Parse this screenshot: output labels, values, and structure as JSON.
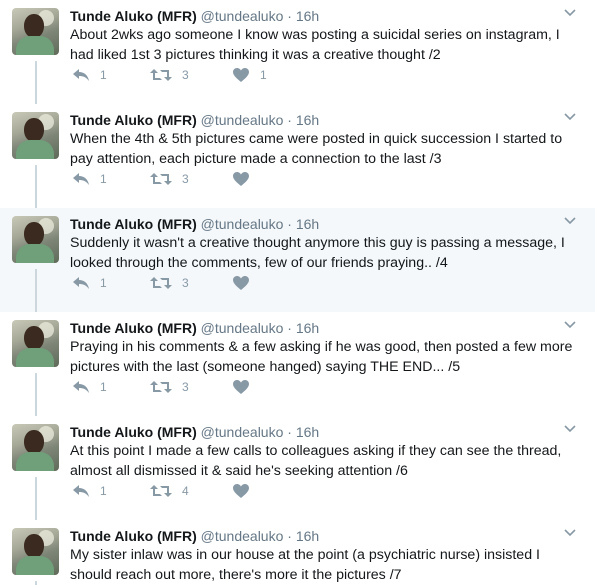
{
  "tweets": [
    {
      "name": "Tunde Aluko (MFR)",
      "handle": "@tundealuko",
      "time": "16h",
      "text": "About 2wks ago someone I know was posting a suicidal series on instagram, I had liked 1st 3 pictures thinking it was a creative thought /2",
      "replies": "1",
      "retweets": "3",
      "likes": "1",
      "highlighted": false
    },
    {
      "name": "Tunde Aluko (MFR)",
      "handle": "@tundealuko",
      "time": "16h",
      "text": "When the 4th & 5th pictures came were posted in quick succession I started to pay attention, each picture made a connection to the last /3",
      "replies": "1",
      "retweets": "3",
      "likes": "",
      "highlighted": false
    },
    {
      "name": "Tunde Aluko (MFR)",
      "handle": "@tundealuko",
      "time": "16h",
      "text": "Suddenly it wasn't a creative thought anymore this guy is passing a message, I looked through the comments,  few of our friends praying.. /4",
      "replies": "1",
      "retweets": "3",
      "likes": "",
      "highlighted": true
    },
    {
      "name": "Tunde Aluko (MFR)",
      "handle": "@tundealuko",
      "time": "16h",
      "text": "Praying in his comments & a few asking if he was good, then posted a few more pictures with the last (someone hanged) saying THE END... /5",
      "replies": "1",
      "retweets": "3",
      "likes": "",
      "highlighted": false
    },
    {
      "name": "Tunde Aluko (MFR)",
      "handle": "@tundealuko",
      "time": "16h",
      "text": "At this point I made a few calls to colleagues  asking if they can see the thread, almost all dismissed it & said he's seeking attention /6",
      "replies": "1",
      "retweets": "4",
      "likes": "",
      "highlighted": false
    },
    {
      "name": "Tunde Aluko (MFR)",
      "handle": "@tundealuko",
      "time": "16h",
      "text": "My sister inlaw was in our house at the point (a psychiatric nurse) insisted I should reach out more, there's more it the pictures /7",
      "replies": "",
      "retweets": "",
      "likes": "",
      "highlighted": false
    }
  ]
}
